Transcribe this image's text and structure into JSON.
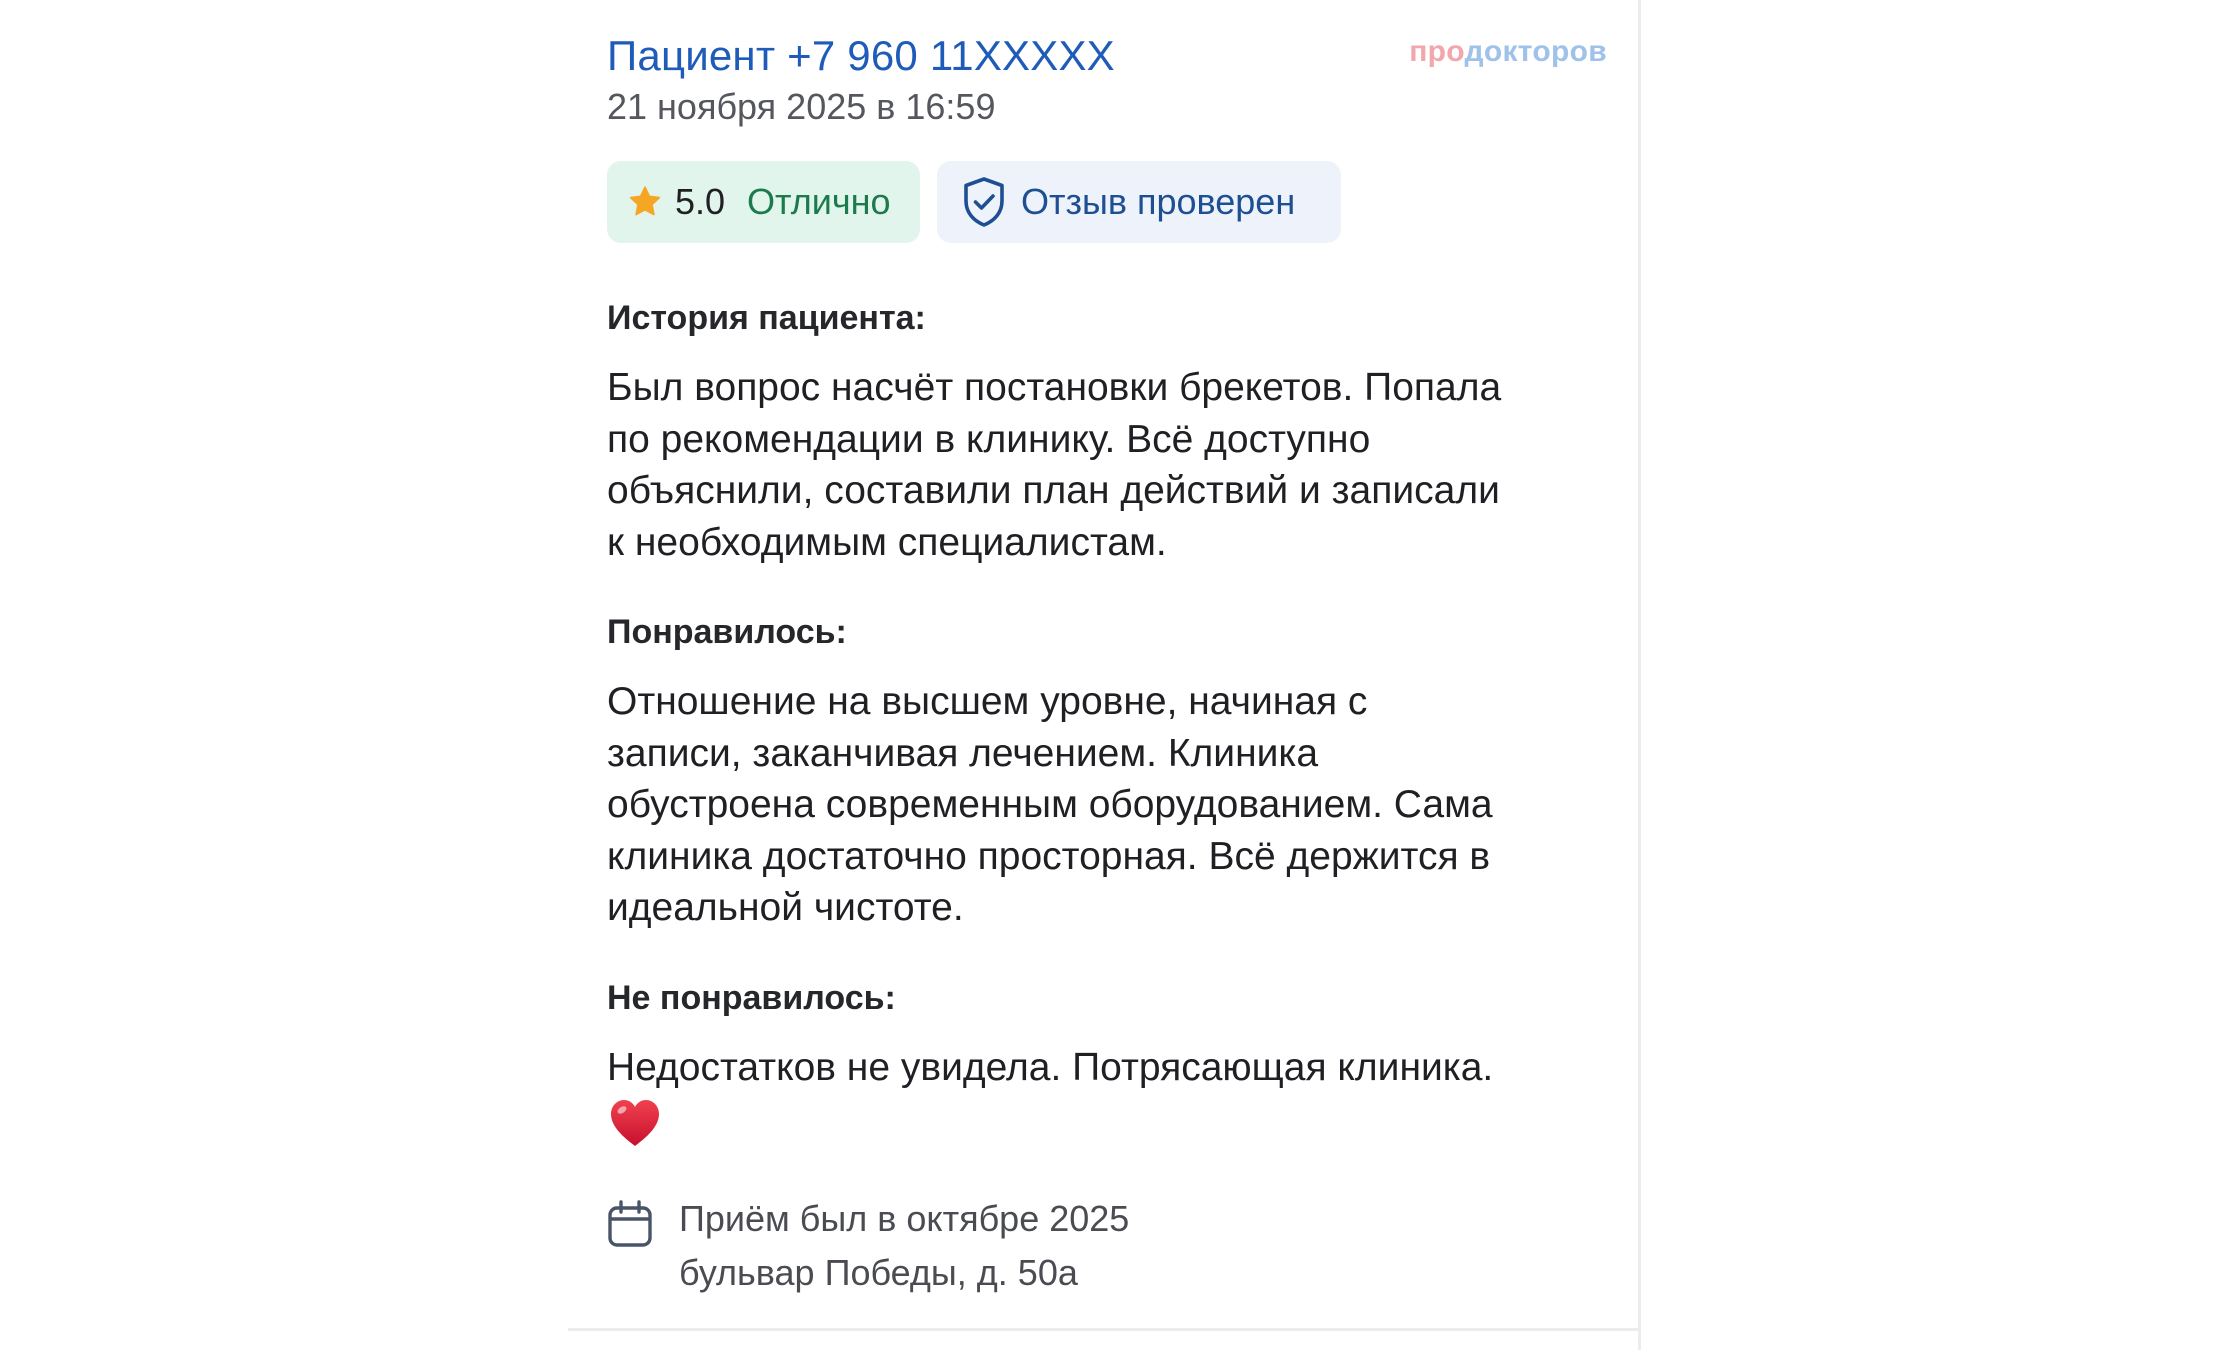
{
  "review": {
    "author": "Пациент +7 960 11XXXXX",
    "date": "21 ноября 2025 в 16:59",
    "brand": {
      "part1": "про",
      "part2": "докторов"
    },
    "rating": {
      "value": "5.0",
      "label": "Отлично",
      "icon": "star-icon",
      "color": "#f5a623"
    },
    "verified": {
      "label": "Отзыв проверен",
      "icon": "shield-check-icon"
    },
    "sections": [
      {
        "title": "История пациента:",
        "body": "Был вопрос насчёт постановки брекетов. Попала\nпо рекомендации в клинику. Всё доступно\nобъяснили, составили план действий и записали\nк необходимым специалистам."
      },
      {
        "title": "Понравилось:",
        "body": "Отношение на высшем уровне, начиная с\nзаписи, заканчивая лечением. Клиника\nобустроена современным оборудованием. Сама\nклиника достаточно просторная. Всё держится в\nидеальной чистоте."
      },
      {
        "title": "Не понравилось:",
        "body": "Недостатков не увидела. Потрясающая клиника.",
        "emoji": "heart-emoji"
      }
    ],
    "visit": {
      "icon": "calendar-icon",
      "date": "Приём был в октябре 2025",
      "address": "бульвар Победы, д. 50а"
    },
    "colors": {
      "author": "#1f5bb8",
      "rating_bg": "#e1f5ec",
      "rating_text": "#1c7a4c",
      "verified_bg": "#eef3fb",
      "verified_text": "#1e4f93"
    }
  }
}
